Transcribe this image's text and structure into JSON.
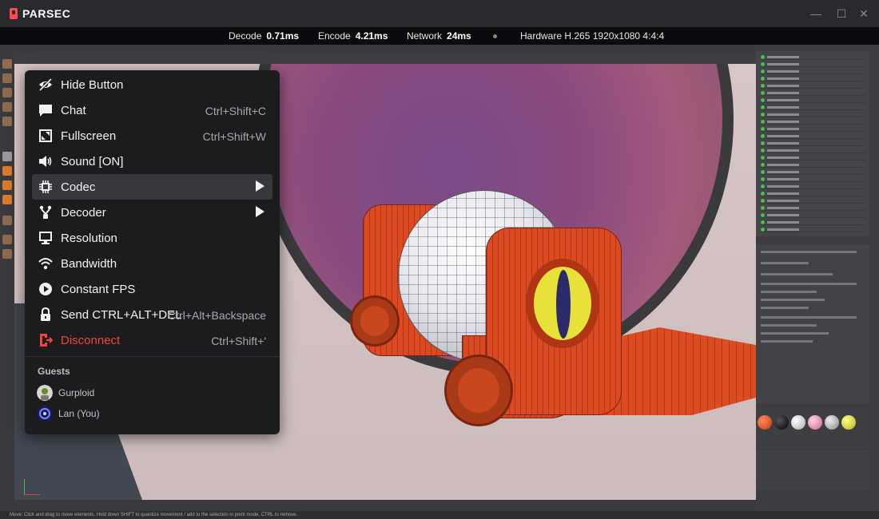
{
  "app": {
    "name": "PARSEC"
  },
  "window_controls": {
    "minimize": "—",
    "maximize": "☐",
    "close": "✕"
  },
  "stats": {
    "decode_label": "Decode",
    "decode_value": "0.71ms",
    "encode_label": "Encode",
    "encode_value": "4.21ms",
    "network_label": "Network",
    "network_value": "24ms",
    "hardware_label": "Hardware H.265 1920x1080 4:4:4"
  },
  "menu": {
    "items": [
      {
        "label": "Hide Button",
        "shortcut": "",
        "icon": "eye-off-icon"
      },
      {
        "label": "Chat",
        "shortcut": "Ctrl+Shift+C",
        "icon": "chat-icon"
      },
      {
        "label": "Fullscreen",
        "shortcut": "Ctrl+Shift+W",
        "icon": "fullscreen-icon"
      },
      {
        "label": "Sound [ON]",
        "shortcut": "",
        "icon": "speaker-icon"
      },
      {
        "label": "Codec",
        "shortcut": "",
        "icon": "chip-icon",
        "selected": true,
        "submenu": true
      },
      {
        "label": "Decoder",
        "shortcut": "",
        "icon": "decoder-icon",
        "submenu": true
      },
      {
        "label": "Resolution",
        "shortcut": "",
        "icon": "monitor-icon"
      },
      {
        "label": "Bandwidth",
        "shortcut": "",
        "icon": "wifi-icon"
      },
      {
        "label": "Constant FPS",
        "shortcut": "",
        "icon": "play-icon"
      },
      {
        "label": "Send CTRL+ALT+DEL",
        "shortcut": "Ctrl+Alt+Backspace",
        "icon": "lock-icon"
      },
      {
        "label": "Disconnect",
        "shortcut": "Ctrl+Shift+'",
        "icon": "disconnect-icon",
        "danger": true
      }
    ],
    "guests_heading": "Guests",
    "guests": [
      {
        "name": "Gurploid"
      },
      {
        "name": "Lan (You)"
      }
    ]
  },
  "remote": {
    "status_text": "Move: Click and drag to move elements. Hold down SHIFT to quantize movement / add to the selection in point mode, CTRL to remove."
  },
  "colors": {
    "accent_danger": "#f0463c",
    "menu_bg": "#1c1c1e",
    "menu_selected": "#38383c",
    "titlebar": "#2a2a2e"
  }
}
